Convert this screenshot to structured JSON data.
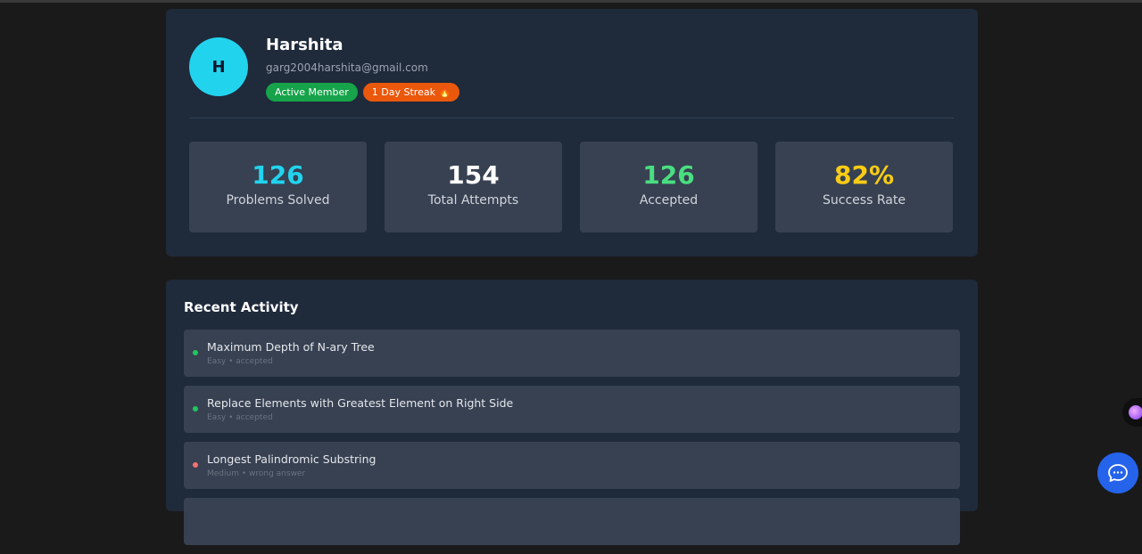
{
  "profile": {
    "avatar_initial": "H",
    "name": "Harshita",
    "email": "garg2004harshita@gmail.com",
    "badges": [
      {
        "label": "Active Member",
        "color": "#16a34a"
      },
      {
        "label": "1 Day Streak 🔥",
        "color": "#ea580c"
      }
    ]
  },
  "stats": [
    {
      "value": "126",
      "label": "Problems Solved",
      "color": "#22d3ee"
    },
    {
      "value": "154",
      "label": "Total Attempts",
      "color": "#ffffff"
    },
    {
      "value": "126",
      "label": "Accepted",
      "color": "#4ade80"
    },
    {
      "value": "82%",
      "label": "Success Rate",
      "color": "#facc15"
    }
  ],
  "activity": {
    "title": "Recent Activity",
    "items": [
      {
        "title": "Maximum Depth of N-ary Tree",
        "meta": "Easy • accepted",
        "status_color": "#22c55e"
      },
      {
        "title": "Replace Elements with Greatest Element on Right Side",
        "meta": "Easy • accepted",
        "status_color": "#22c55e"
      },
      {
        "title": "Longest Palindromic Substring",
        "meta": "Medium • wrong answer",
        "status_color": "#f87171"
      }
    ]
  },
  "icons": {
    "chat": "chat-bubble-icon",
    "assistant": "assistant-orb-icon"
  }
}
